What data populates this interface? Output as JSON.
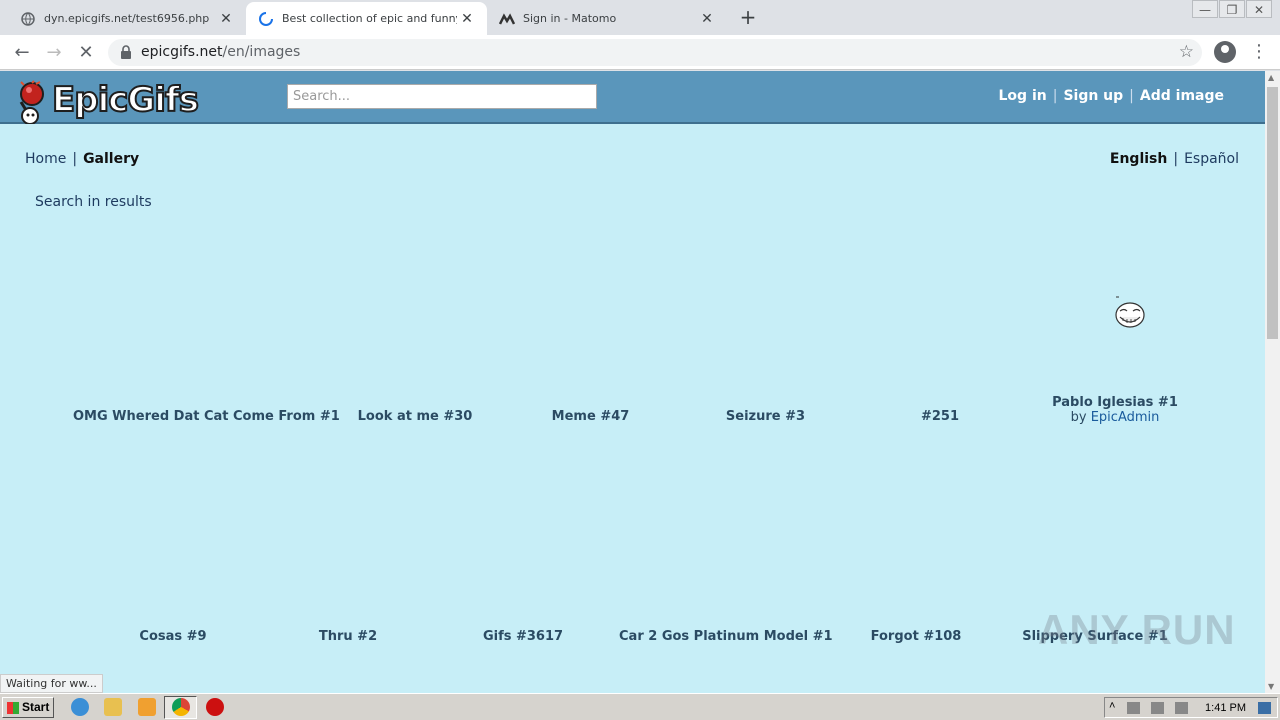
{
  "browser": {
    "tabs": [
      {
        "label": "dyn.epicgifs.net/test6956.php",
        "icon": "globe-icon"
      },
      {
        "label": "Best collection of epic and funny gifs",
        "icon": "loading-spinner-icon"
      },
      {
        "label": "Sign in - Matomo",
        "icon": "matomo-icon"
      }
    ],
    "url_host": "epicgifs.net",
    "url_path": "/en/images",
    "status_text": "Waiting for ww..."
  },
  "site": {
    "logo_text": "EpicGifs",
    "search_placeholder": "Search...",
    "auth": {
      "login": "Log in",
      "signup": "Sign up",
      "add_image": "Add image"
    },
    "breadcrumb": {
      "home": "Home",
      "current": "Gallery"
    },
    "languages": {
      "current": "English",
      "other": "Español"
    },
    "search_in_results": "Search in results"
  },
  "gallery": {
    "row1": [
      {
        "title": "OMG Whered Dat Cat Come From #1"
      },
      {
        "title": "Look at me #30"
      },
      {
        "title": "Meme #47"
      },
      {
        "title": "Seizure #3"
      },
      {
        "title": "#251"
      },
      {
        "title": "Pablo Iglesias #1",
        "by_prefix": "by",
        "author": "EpicAdmin"
      }
    ],
    "row2": [
      {
        "title": "Cosas #9"
      },
      {
        "title": "Thru #2"
      },
      {
        "title": "Gifs #3617"
      },
      {
        "title": "Car 2 Gos Platinum Model #1"
      },
      {
        "title": "Forgot #108"
      },
      {
        "title": "Slippery Surface #1"
      }
    ]
  },
  "watermark": "ANY RUN",
  "taskbar": {
    "start_label": "Start",
    "clock": "1:41 PM"
  }
}
